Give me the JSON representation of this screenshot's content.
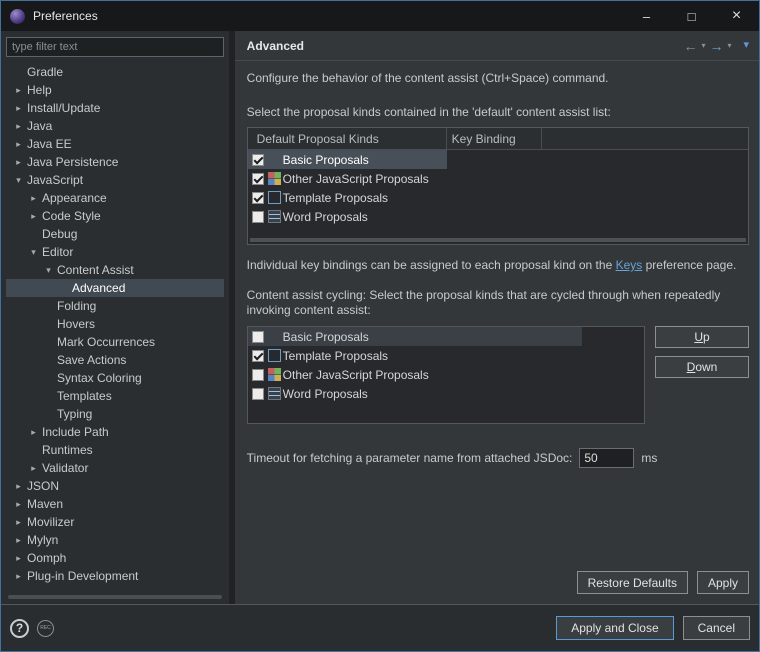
{
  "window": {
    "title": "Preferences",
    "controls": {
      "minimize_glyph": "–",
      "maximize_glyph": "□",
      "close_glyph": "×"
    }
  },
  "sidebar": {
    "filter": {
      "placeholder": "type filter text"
    },
    "tree": [
      {
        "label": "Gradle",
        "level": 0,
        "arrow": "none",
        "selected": false
      },
      {
        "label": "Help",
        "level": 0,
        "arrow": "collapsed",
        "selected": false
      },
      {
        "label": "Install/Update",
        "level": 0,
        "arrow": "collapsed",
        "selected": false
      },
      {
        "label": "Java",
        "level": 0,
        "arrow": "collapsed",
        "selected": false
      },
      {
        "label": "Java EE",
        "level": 0,
        "arrow": "collapsed",
        "selected": false
      },
      {
        "label": "Java Persistence",
        "level": 0,
        "arrow": "collapsed",
        "selected": false
      },
      {
        "label": "JavaScript",
        "level": 0,
        "arrow": "expanded",
        "selected": false
      },
      {
        "label": "Appearance",
        "level": 1,
        "arrow": "collapsed",
        "selected": false
      },
      {
        "label": "Code Style",
        "level": 1,
        "arrow": "collapsed",
        "selected": false
      },
      {
        "label": "Debug",
        "level": 1,
        "arrow": "none",
        "selected": false
      },
      {
        "label": "Editor",
        "level": 1,
        "arrow": "expanded",
        "selected": false
      },
      {
        "label": "Content Assist",
        "level": 2,
        "arrow": "expanded",
        "selected": false
      },
      {
        "label": "Advanced",
        "level": 3,
        "arrow": "none",
        "selected": true
      },
      {
        "label": "Folding",
        "level": 2,
        "arrow": "none",
        "selected": false
      },
      {
        "label": "Hovers",
        "level": 2,
        "arrow": "none",
        "selected": false
      },
      {
        "label": "Mark Occurrences",
        "level": 2,
        "arrow": "none",
        "selected": false
      },
      {
        "label": "Save Actions",
        "level": 2,
        "arrow": "none",
        "selected": false
      },
      {
        "label": "Syntax Coloring",
        "level": 2,
        "arrow": "none",
        "selected": false
      },
      {
        "label": "Templates",
        "level": 2,
        "arrow": "none",
        "selected": false
      },
      {
        "label": "Typing",
        "level": 2,
        "arrow": "none",
        "selected": false
      },
      {
        "label": "Include Path",
        "level": 1,
        "arrow": "collapsed",
        "selected": false
      },
      {
        "label": "Runtimes",
        "level": 1,
        "arrow": "none",
        "selected": false
      },
      {
        "label": "Validator",
        "level": 1,
        "arrow": "collapsed",
        "selected": false
      },
      {
        "label": "JSON",
        "level": 0,
        "arrow": "collapsed",
        "selected": false
      },
      {
        "label": "Maven",
        "level": 0,
        "arrow": "collapsed",
        "selected": false
      },
      {
        "label": "Movilizer",
        "level": 0,
        "arrow": "collapsed",
        "selected": false
      },
      {
        "label": "Mylyn",
        "level": 0,
        "arrow": "collapsed",
        "selected": false
      },
      {
        "label": "Oomph",
        "level": 0,
        "arrow": "collapsed",
        "selected": false
      },
      {
        "label": "Plug-in Development",
        "level": 0,
        "arrow": "collapsed",
        "selected": false
      }
    ]
  },
  "content": {
    "header": {
      "title": "Advanced",
      "nav": {
        "back_glyph": "←",
        "forward_glyph": "→",
        "caret_glyph": "▾",
        "menu_glyph": "▾"
      }
    },
    "description": "Configure the behavior of the content assist (Ctrl+Space) command.",
    "default_list": {
      "label": "Select the proposal kinds contained in the 'default' content assist list:",
      "columns": [
        "Default Proposal Kinds",
        "Key Binding"
      ],
      "rows": [
        {
          "label": "Basic Proposals",
          "checked": true,
          "icon": "blank",
          "selected": true
        },
        {
          "label": "Other JavaScript Proposals",
          "checked": true,
          "icon": "js",
          "selected": false
        },
        {
          "label": "Template Proposals",
          "checked": true,
          "icon": "template",
          "selected": false
        },
        {
          "label": "Word Proposals",
          "checked": false,
          "icon": "word",
          "selected": false
        }
      ]
    },
    "keys_note": {
      "before": "Individual key bindings can be assigned to each proposal kind on the ",
      "link": "Keys",
      "after": " preference page."
    },
    "cycling_list": {
      "label": "Content assist cycling: Select the proposal kinds that are cycled through when repeatedly invoking content assist:",
      "rows": [
        {
          "label": "Basic Proposals",
          "checked": false,
          "icon": "blank",
          "selected": true
        },
        {
          "label": "Template Proposals",
          "checked": true,
          "icon": "template",
          "selected": false
        },
        {
          "label": "Other JavaScript Proposals",
          "checked": false,
          "icon": "js",
          "selected": false
        },
        {
          "label": "Word Proposals",
          "checked": false,
          "icon": "word",
          "selected": false
        }
      ],
      "up_label": "Up",
      "down_label": "Down"
    },
    "timeout": {
      "label": "Timeout for fetching a parameter name from attached JSDoc:",
      "value": "50",
      "unit": "ms"
    },
    "actions": {
      "restore_defaults": "Restore Defaults",
      "apply": "Apply"
    }
  },
  "footer": {
    "help_glyph": "?",
    "rec_label": "REC",
    "apply_and_close": "Apply and Close",
    "cancel": "Cancel"
  }
}
